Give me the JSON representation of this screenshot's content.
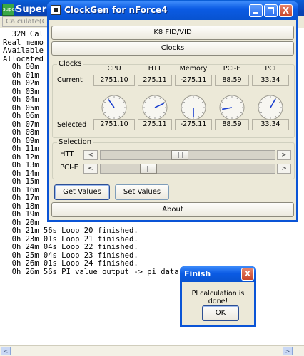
{
  "superpi": {
    "title": "Super PI",
    "icon_text": "super",
    "menu": {
      "calculate": "Calculate(C)"
    },
    "log_lines": [
      "  32M Cal",
      "Real memo",
      "Available",
      "Allocated",
      "  0h 00m",
      "  0h 01m",
      "  0h 02m",
      "  0h 03m",
      "  0h 04m",
      "  0h 05m",
      "  0h 06m",
      "  0h 07m",
      "  0h 08m",
      "  0h 09m",
      "  0h 11m",
      "  0h 12m",
      "  0h 13m",
      "  0h 14m",
      "  0h 15m",
      "  0h 16m",
      "  0h 17m",
      "  0h 18m",
      "  0h 19m",
      "  0h 20m",
      "  0h 21m 56s Loop 20 finished.",
      "  0h 23m 01s Loop 21 finished.",
      "  0h 24m 04s Loop 22 finished.",
      "  0h 25m 04s Loop 23 finished.",
      "  0h 26m 01s Loop 24 finished.",
      "  0h 26m 56s PI value output -> pi_data.txt"
    ],
    "scroll_left": "<",
    "scroll_right": ">"
  },
  "clockgen": {
    "title": "ClockGen for nForce4",
    "tabs": {
      "k8": "K8 FID/VID",
      "clocks": "Clocks"
    },
    "clocks_group": {
      "label": "Clocks",
      "columns": [
        "CPU",
        "HTT",
        "Memory",
        "PCI-E",
        "PCI"
      ],
      "current_label": "Current",
      "selected_label": "Selected",
      "current": [
        "2751.10",
        "275.11",
        "-275.11",
        "88.59",
        "33.34"
      ],
      "selected": [
        "2751.10",
        "275.11",
        "-275.11",
        "88.59",
        "33.34"
      ],
      "dial_angles_deg": [
        -35,
        65,
        180,
        -100,
        30
      ]
    },
    "selection_group": {
      "label": "Selection",
      "htt_label": "HTT",
      "pcie_label": "PCI-E",
      "htt_slider_position": 0.45,
      "pcie_slider_position": 0.25,
      "arrow_left": "<",
      "arrow_right": ">"
    },
    "buttons": {
      "get": "Get Values",
      "set": "Set Values",
      "about": "About"
    }
  },
  "finish_dialog": {
    "title": "Finish",
    "message": "PI calculation is done!",
    "ok": "OK",
    "close_glyph": "X"
  },
  "window_controls": {
    "close_glyph": "X"
  },
  "colors": {
    "titlebar_blue": "#0a54d6",
    "close_red": "#c8452a",
    "window_bg": "#ece9d8"
  }
}
